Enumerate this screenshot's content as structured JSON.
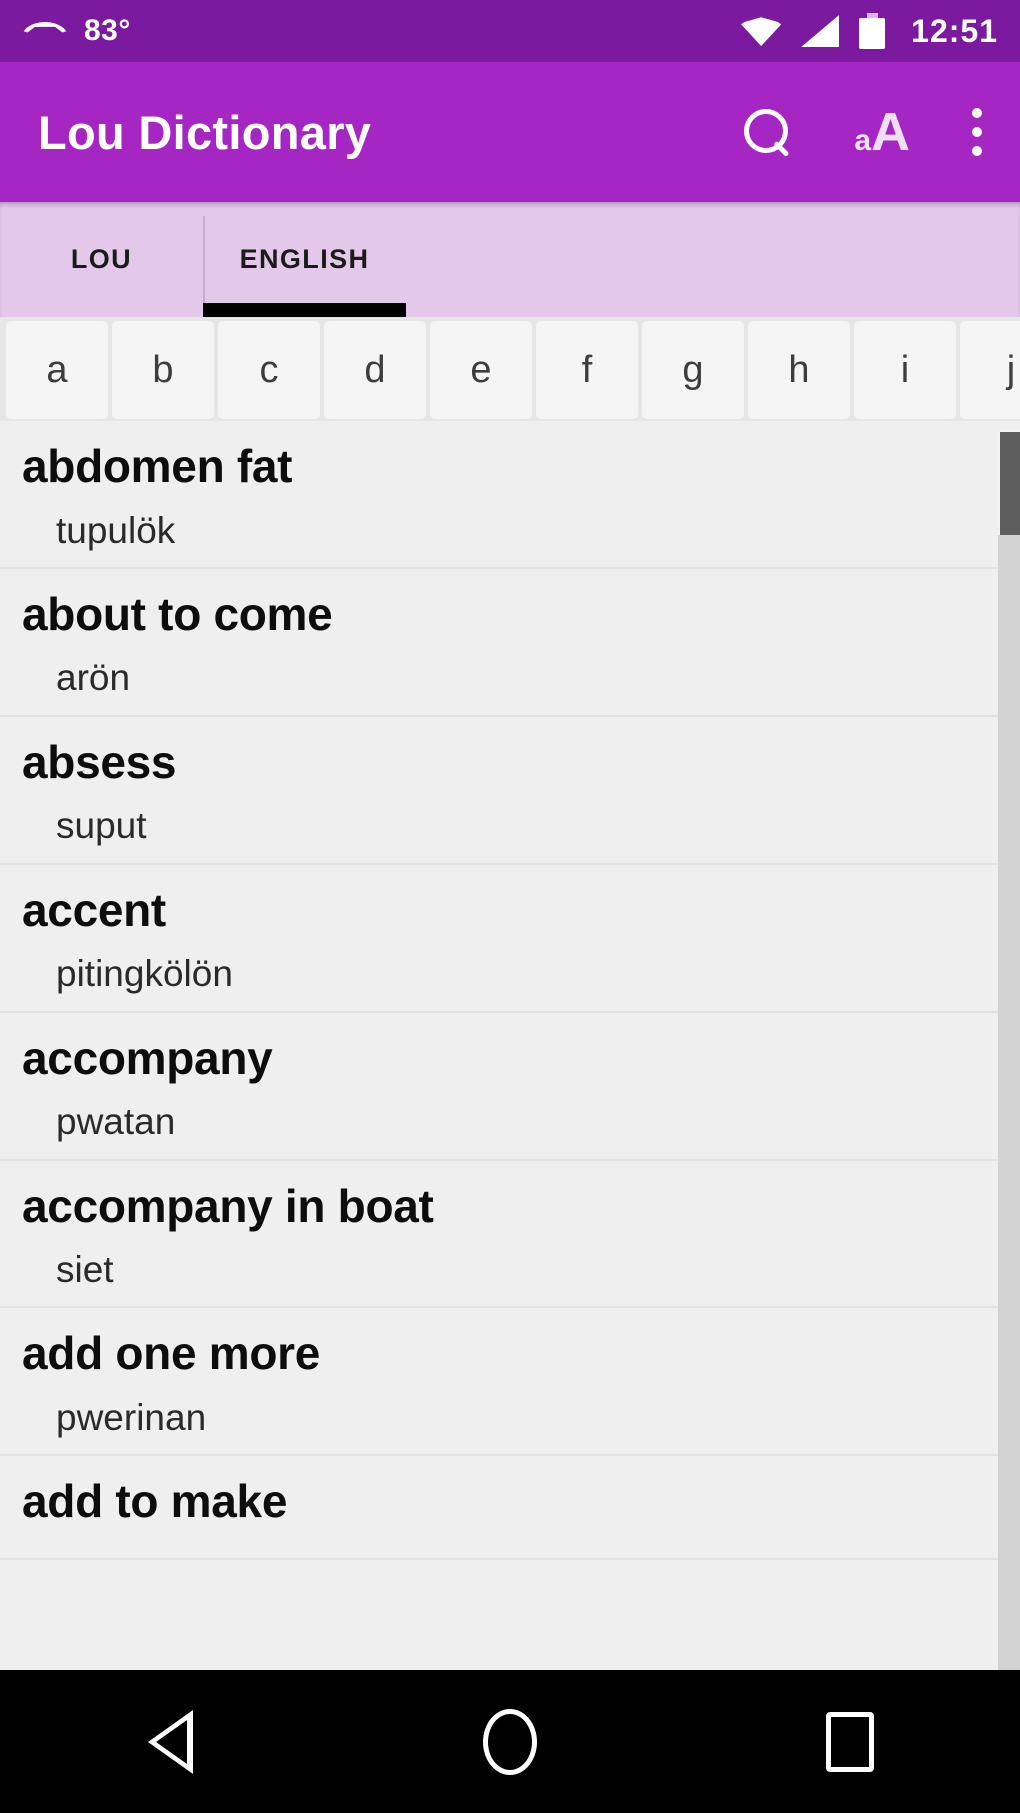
{
  "status_bar": {
    "weather_icon": "cloud-icon",
    "temperature": "83°",
    "wifi_icon": "wifi-icon",
    "signal_icon": "cellular-signal-icon",
    "battery_icon": "battery-icon",
    "clock": "12:51"
  },
  "app_bar": {
    "title": "Lou Dictionary",
    "search_icon": "search-icon",
    "font_size_icon_small": "a",
    "font_size_icon_big": "A",
    "overflow_icon": "more-vertical-icon"
  },
  "tabs": [
    {
      "label": "LOU",
      "active": false
    },
    {
      "label": "ENGLISH",
      "active": true
    }
  ],
  "alphabet": [
    "a",
    "b",
    "c",
    "d",
    "e",
    "f",
    "g",
    "h",
    "i",
    "j"
  ],
  "entries": [
    {
      "head": "abdomen fat",
      "gloss": "tupulök"
    },
    {
      "head": "about to come",
      "gloss": "arön"
    },
    {
      "head": "absess",
      "gloss": "suput"
    },
    {
      "head": "accent",
      "gloss": "pitingkölön"
    },
    {
      "head": "accompany",
      "gloss": "pwatan"
    },
    {
      "head": "accompany in boat",
      "gloss": "siet"
    },
    {
      "head": "add one more",
      "gloss": "pwerinan"
    },
    {
      "head": "add to make",
      "gloss": ""
    }
  ],
  "nav_bar": {
    "back_icon": "back-triangle-icon",
    "home_icon": "home-circle-icon",
    "recents_icon": "recents-square-icon"
  },
  "colors": {
    "status_bar": "#7B1A9E",
    "app_bar": "#A626C4",
    "tab_bar": "#E3C8EA",
    "tab_indicator": "#000000",
    "list_background": "#EFEFEF",
    "nav_bar": "#000000"
  }
}
